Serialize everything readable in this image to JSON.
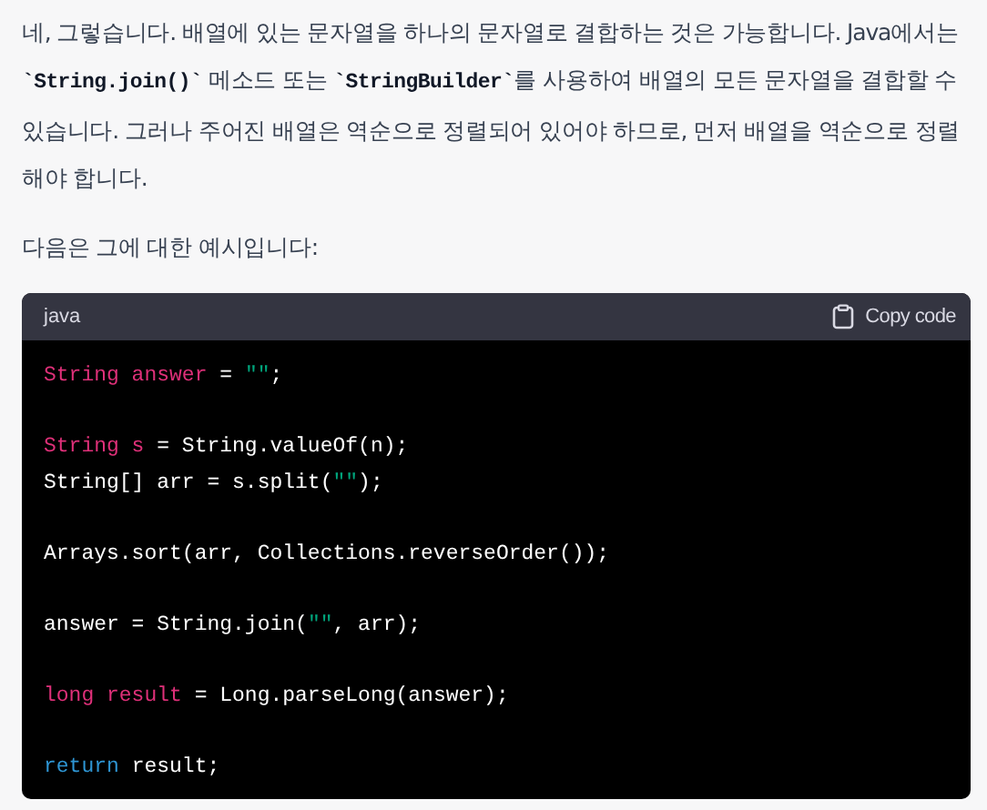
{
  "paragraphs": [
    {
      "segments": [
        {
          "kind": "text",
          "text": "네, 그렇습니다. 배열에 있는 문자열을 하나의 문자열로 결합하는 것은 가능합니다. Java에서는 "
        },
        {
          "kind": "code",
          "text": "`String.join()`"
        },
        {
          "kind": "text",
          "text": " 메소드 또는 "
        },
        {
          "kind": "code",
          "text": "`StringBuilder`"
        },
        {
          "kind": "text",
          "text": "를 사용하여 배열의 모든 문자열을 결합할 수 있습니다. 그러나 주어진 배열은 역순으로 정렬되어 있어야 하므로, 먼저 배열을 역순으로 정렬해야 합니다."
        }
      ]
    },
    {
      "segments": [
        {
          "kind": "text",
          "text": "다음은 그에 대한 예시입니다:"
        }
      ]
    }
  ],
  "code_block": {
    "language": "java",
    "copy_label": "Copy code",
    "blocks": [
      [
        [
          {
            "kind": "type",
            "text": "String answer"
          },
          {
            "kind": "plain",
            "text": " = "
          },
          {
            "kind": "string",
            "text": "\"\""
          },
          {
            "kind": "plain",
            "text": ";"
          }
        ]
      ],
      [
        [
          {
            "kind": "type",
            "text": "String s"
          },
          {
            "kind": "plain",
            "text": " = String.valueOf(n);"
          }
        ],
        [
          {
            "kind": "plain",
            "text": "String[] arr = s.split("
          },
          {
            "kind": "string",
            "text": "\"\""
          },
          {
            "kind": "plain",
            "text": ");"
          }
        ]
      ],
      [
        [
          {
            "kind": "plain",
            "text": "Arrays.sort(arr, Collections.reverseOrder());"
          }
        ]
      ],
      [
        [
          {
            "kind": "plain",
            "text": "answer = String.join("
          },
          {
            "kind": "string",
            "text": "\"\""
          },
          {
            "kind": "plain",
            "text": ", arr);"
          }
        ]
      ],
      [
        [
          {
            "kind": "type",
            "text": "long result"
          },
          {
            "kind": "plain",
            "text": " = Long.parseLong(answer);"
          }
        ]
      ],
      [
        [
          {
            "kind": "keyword",
            "text": "return"
          },
          {
            "kind": "plain",
            "text": " result;"
          }
        ]
      ]
    ]
  }
}
